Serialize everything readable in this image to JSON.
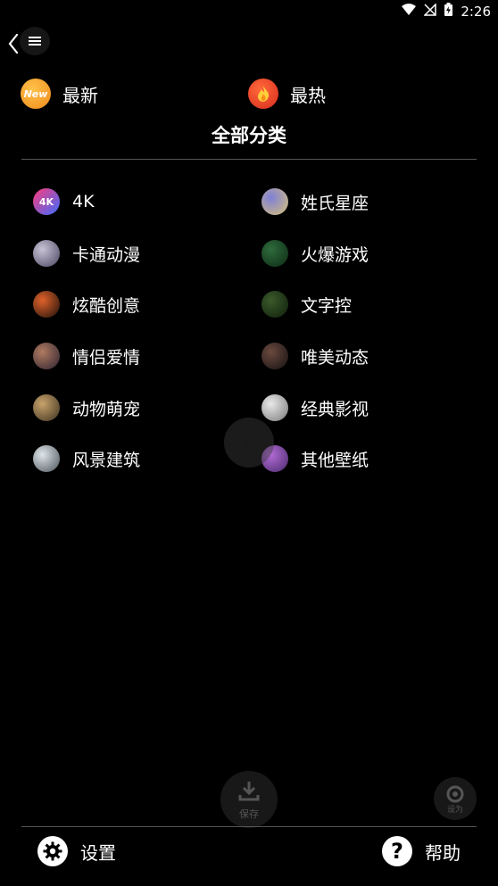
{
  "status_bar": {
    "time": "2:26",
    "icons": [
      "wifi-icon",
      "no-signal-icon",
      "battery-charging-icon"
    ]
  },
  "nav": {
    "back_icon": "chevron-left-icon",
    "menu_icon": "hamburger-menu-icon"
  },
  "top_row": [
    {
      "label": "最新",
      "badge_text": "New",
      "badge_color": "#f5a623",
      "icon": "new-badge-icon"
    },
    {
      "label": "最热",
      "badge_color": "#e8402a",
      "icon": "fire-icon"
    }
  ],
  "section_title": "全部分类",
  "categories": [
    {
      "label": "4K",
      "thumb_text": "4K",
      "icon": "4k-badge-icon",
      "colors": [
        "#ff3b7a",
        "#3b6bff"
      ]
    },
    {
      "label": "姓氏星座",
      "icon": "cartoon-thumbnail",
      "colors": [
        "#7e7fd6",
        "#d9c27a"
      ]
    },
    {
      "label": "卡通动漫",
      "icon": "anime-thumbnail",
      "colors": [
        "#c9c3d6",
        "#4a4460"
      ]
    },
    {
      "label": "火爆游戏",
      "icon": "game-thumbnail",
      "colors": [
        "#2f6b3c",
        "#0c2a14"
      ]
    },
    {
      "label": "炫酷创意",
      "icon": "creative-thumbnail",
      "colors": [
        "#e0622a",
        "#1a0f0a"
      ]
    },
    {
      "label": "文字控",
      "icon": "text-thumbnail",
      "colors": [
        "#3a5a2a",
        "#0f1e0c"
      ]
    },
    {
      "label": "情侣爱情",
      "icon": "couple-thumbnail",
      "colors": [
        "#b07a60",
        "#2b2230"
      ]
    },
    {
      "label": "唯美动态",
      "icon": "aesthetic-thumbnail",
      "colors": [
        "#6b4a3f",
        "#141010"
      ]
    },
    {
      "label": "动物萌宠",
      "icon": "pet-thumbnail",
      "colors": [
        "#c9a36b",
        "#3a3020"
      ]
    },
    {
      "label": "经典影视",
      "icon": "movie-thumbnail",
      "colors": [
        "#e8e8e8",
        "#7a7a7a"
      ]
    },
    {
      "label": "风景建筑",
      "icon": "landscape-thumbnail",
      "colors": [
        "#dfe6ea",
        "#4a5258"
      ]
    },
    {
      "label": "其他壁纸",
      "icon": "purple-thumbnail",
      "colors": [
        "#b26bd6",
        "#4a2a6b"
      ]
    }
  ],
  "overlays": {
    "play_icon": "play-icon",
    "download_text": "保存",
    "download_icon": "download-icon",
    "camera_text": "设为",
    "camera_icon": "camera-icon"
  },
  "bottom_bar": {
    "settings": {
      "label": "设置",
      "icon": "gear-icon"
    },
    "help": {
      "label": "帮助",
      "icon": "question-icon"
    }
  },
  "colors": {
    "background": "#000000",
    "text": "#ffffff",
    "divider": "#555555"
  }
}
